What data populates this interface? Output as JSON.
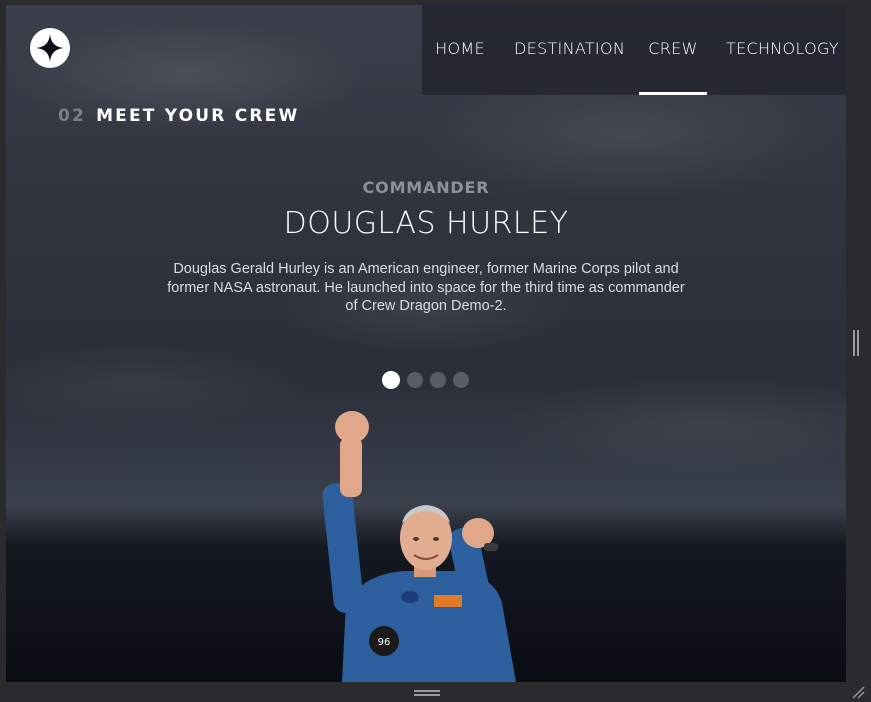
{
  "nav": {
    "items": [
      {
        "label": "HOME"
      },
      {
        "label": "DESTINATION"
      },
      {
        "label": "CREW",
        "active": true
      },
      {
        "label": "TECHNOLOGY"
      }
    ]
  },
  "page": {
    "number": "02",
    "title": "MEET YOUR CREW"
  },
  "crew": {
    "role": "COMMANDER",
    "name": "DOUGLAS HURLEY",
    "bio": "Douglas Gerald Hurley is an American engineer, former Marine Corps pilot and former NASA astronaut. He launched into space for the third time as commander of Crew Dragon Demo-2.",
    "slides_total": 4,
    "active_slide": 1
  },
  "icons": {
    "logo": "star-logo-icon",
    "resize_horizontal": "grip-horizontal-icon",
    "resize_vertical": "grip-vertical-icon",
    "resize_corner": "resize-corner-icon"
  },
  "colors": {
    "accent": "#ffffff",
    "nav_background": "#1e212a",
    "background_dark": "#0b0d14"
  }
}
